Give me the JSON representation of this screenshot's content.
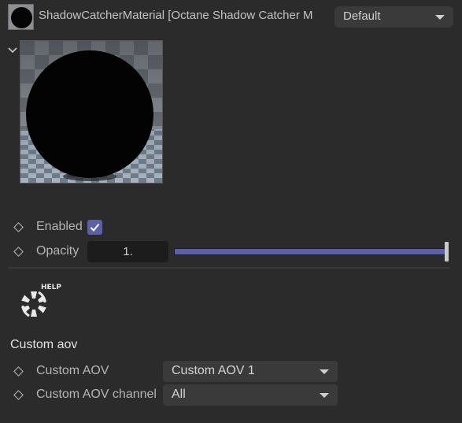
{
  "header": {
    "material_title": "ShadowCatcherMaterial [Octane Shadow Catcher M",
    "preset_value": "Default",
    "material_icon": "material-ball-icon"
  },
  "preview": {
    "icon": "material-preview-sphere"
  },
  "params": {
    "enabled": {
      "label": "Enabled",
      "checked": true
    },
    "opacity": {
      "label": "Opacity",
      "value": "1.",
      "level": 1.0
    }
  },
  "help": {
    "label": "HELP",
    "icon": "octane-logo-icon"
  },
  "custom_aov": {
    "section_title": "Custom aov",
    "aov": {
      "label": "Custom AOV",
      "value": "Custom AOV 1"
    },
    "channel": {
      "label": "Custom AOV channel",
      "value": "All"
    }
  },
  "colors": {
    "accent": "#5c60a8",
    "background": "#2b2b2b",
    "field": "#3a3a3a"
  }
}
